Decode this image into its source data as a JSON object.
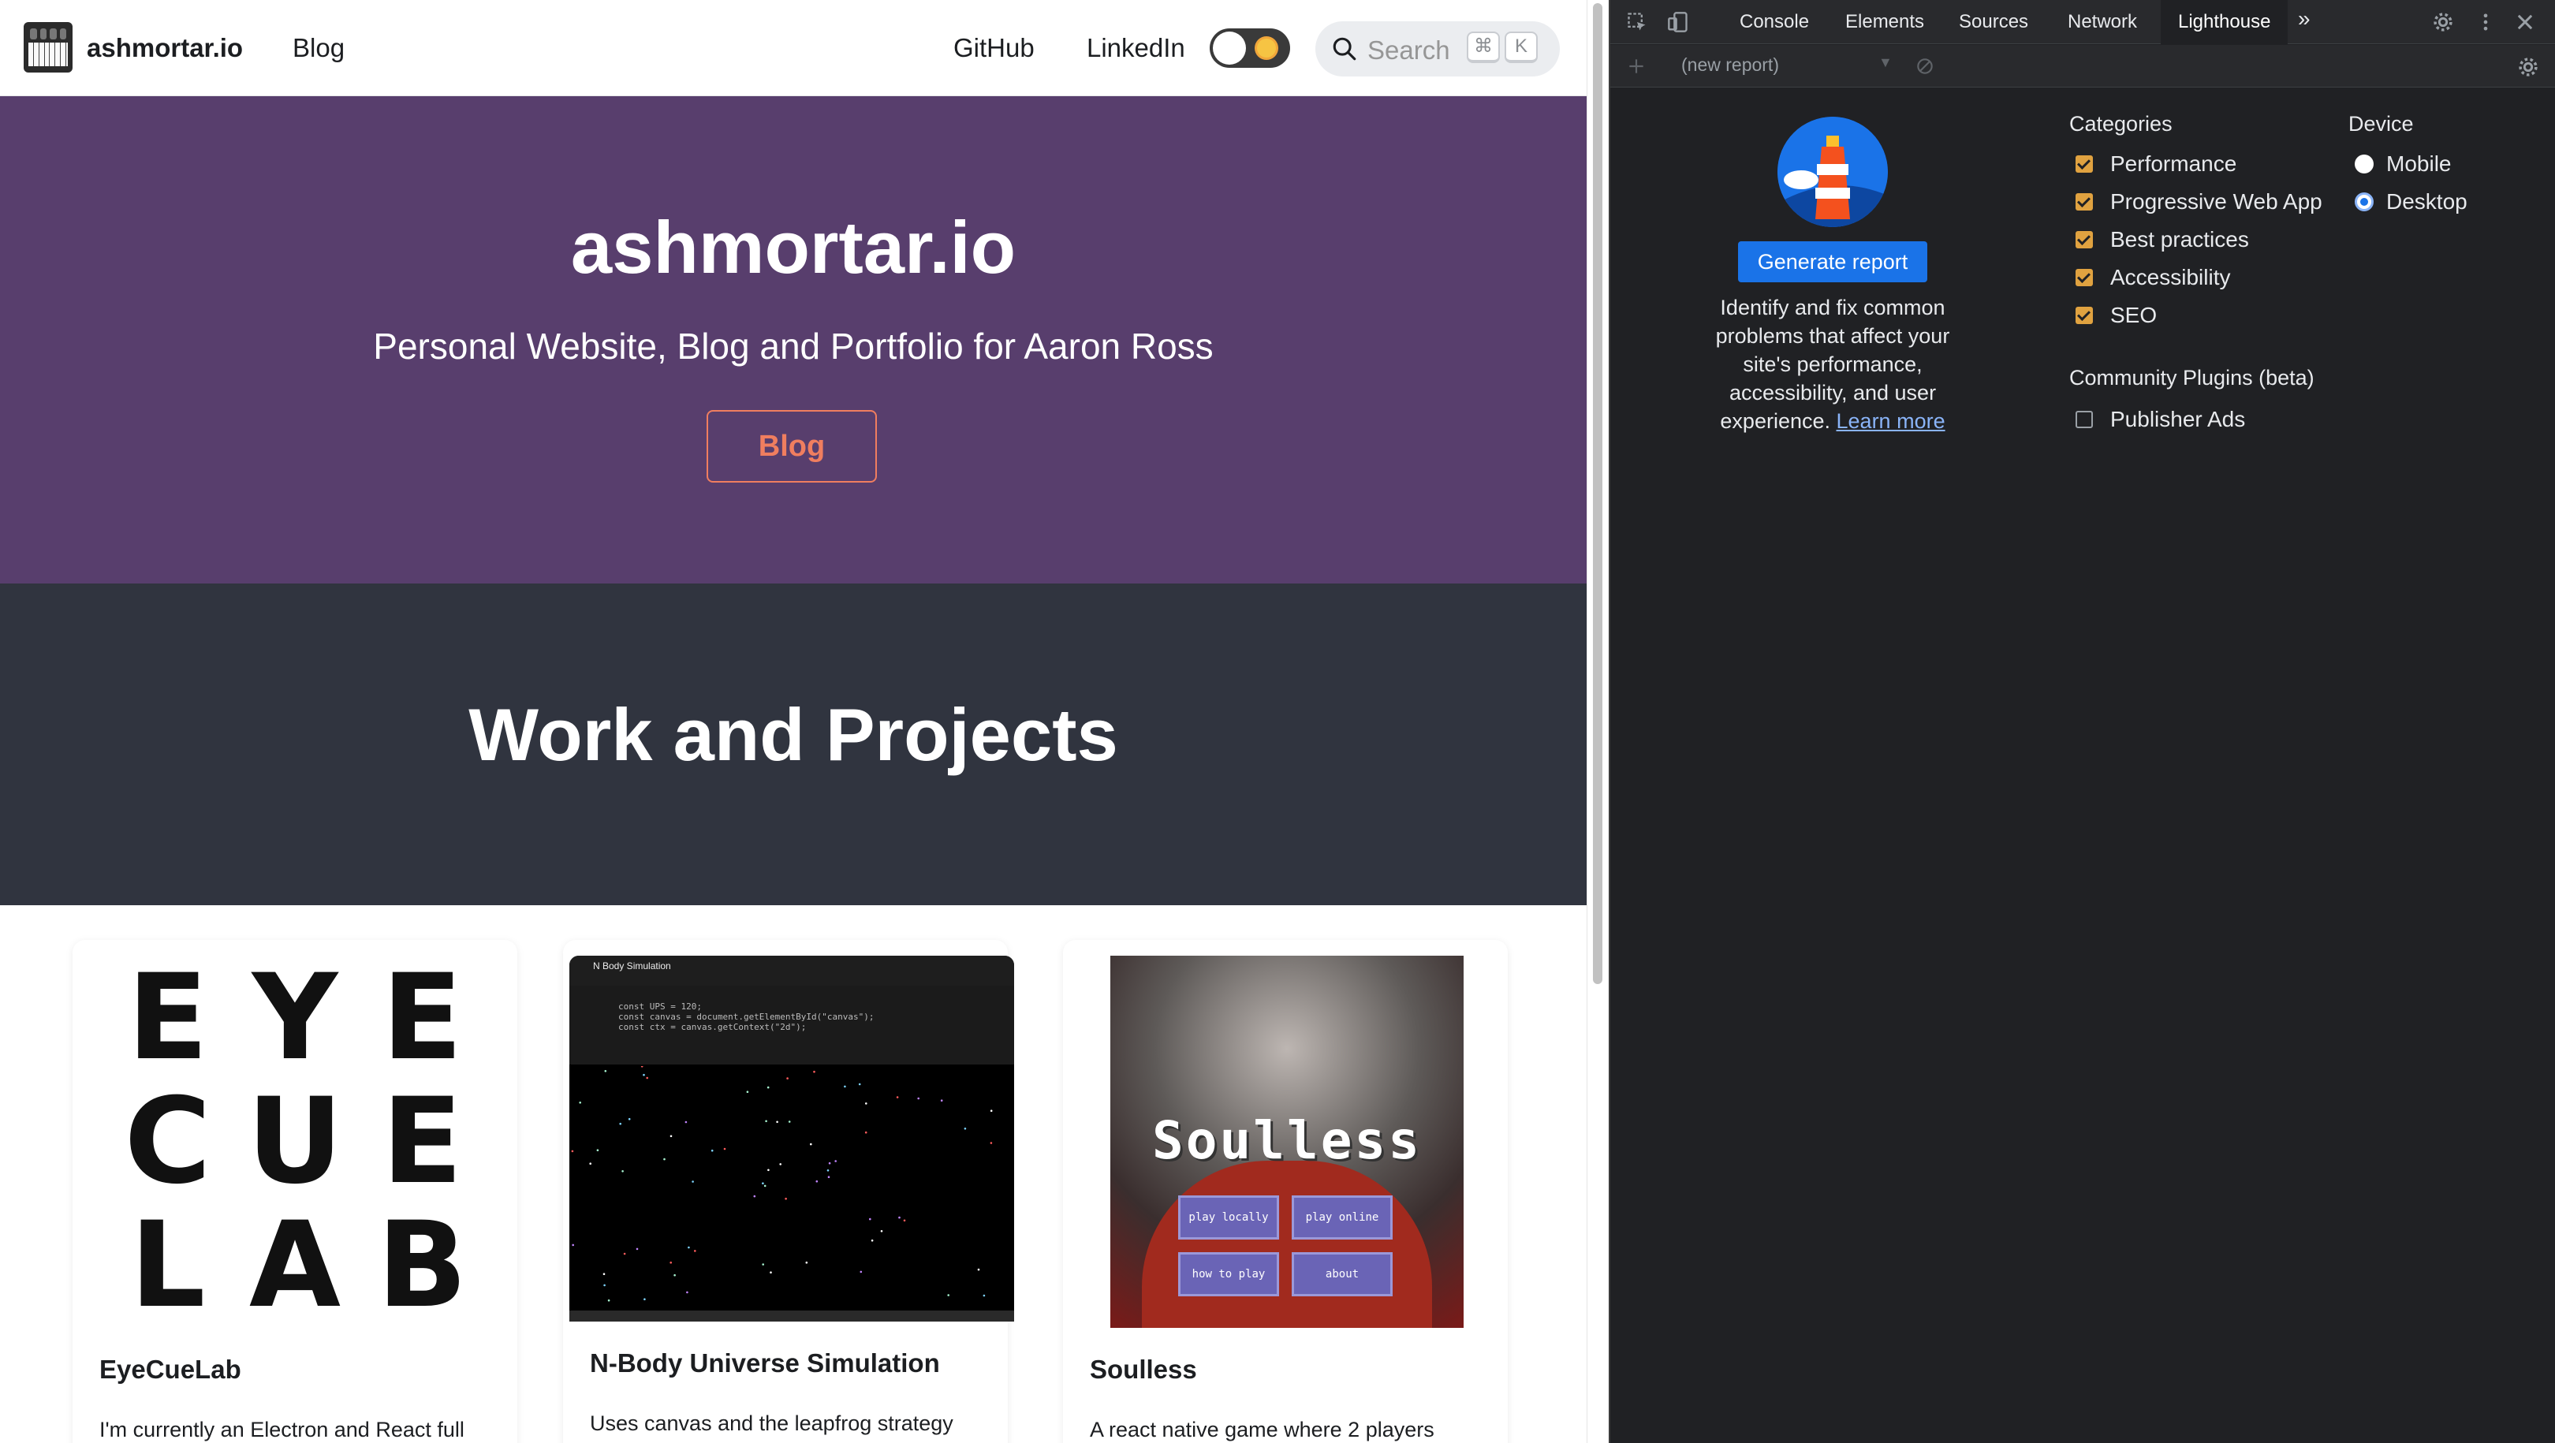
{
  "site": {
    "nav": {
      "brand": "ashmortar.io",
      "blog": "Blog",
      "github": "GitHub",
      "linkedin": "LinkedIn",
      "search_placeholder": "Search",
      "kbd_cmd": "⌘",
      "kbd_k": "K"
    },
    "hero": {
      "title": "ashmortar.io",
      "subtitle": "Personal Website, Blog and Portfolio for Aaron Ross",
      "button": "Blog"
    },
    "work": {
      "title": "Work and Projects"
    },
    "cards": [
      {
        "title": "EyeCueLab",
        "desc": "I'm currently an Electron and React full",
        "logo_letters": [
          "E",
          "Y",
          "E",
          "C",
          "U",
          "E",
          "L",
          "A",
          "B"
        ]
      },
      {
        "title": "N-Body Universe Simulation",
        "desc": "Uses canvas and the leapfrog strategy",
        "screenshot_header": "N Body Simulation",
        "code_lines": [
          "const UPS = 120;",
          "const canvas = document.getElementById(\"canvas\");",
          "const ctx = canvas.getContext(\"2d\");"
        ]
      },
      {
        "title": "Soulless",
        "desc": "A react native game where 2 players",
        "art_title": "Soulless",
        "art_buttons": [
          "play locally",
          "play online",
          "how to play",
          "about"
        ]
      }
    ]
  },
  "devtools": {
    "tabs": [
      "Console",
      "Elements",
      "Sources",
      "Network",
      "Lighthouse"
    ],
    "active_tab": "Lighthouse",
    "report_select": "(new report)",
    "generate_button": "Generate report",
    "description": "Identify and fix common problems that affect your site's performance, accessibility, and user experience.",
    "learn_more": "Learn more",
    "categories_heading": "Categories",
    "categories": [
      {
        "label": "Performance",
        "checked": true
      },
      {
        "label": "Progressive Web App",
        "checked": true
      },
      {
        "label": "Best practices",
        "checked": true
      },
      {
        "label": "Accessibility",
        "checked": true
      },
      {
        "label": "SEO",
        "checked": true
      }
    ],
    "plugins_heading": "Community Plugins (beta)",
    "plugins": [
      {
        "label": "Publisher Ads",
        "checked": false
      }
    ],
    "device_heading": "Device",
    "devices": [
      {
        "label": "Mobile",
        "selected": false
      },
      {
        "label": "Desktop",
        "selected": true
      }
    ]
  },
  "colors": {
    "hero_bg": "#583e6d",
    "work_bg": "#30343f",
    "accent_orange": "#f07e5f",
    "devtools_bg": "#202124",
    "lighthouse_blue": "#1a73e8"
  }
}
